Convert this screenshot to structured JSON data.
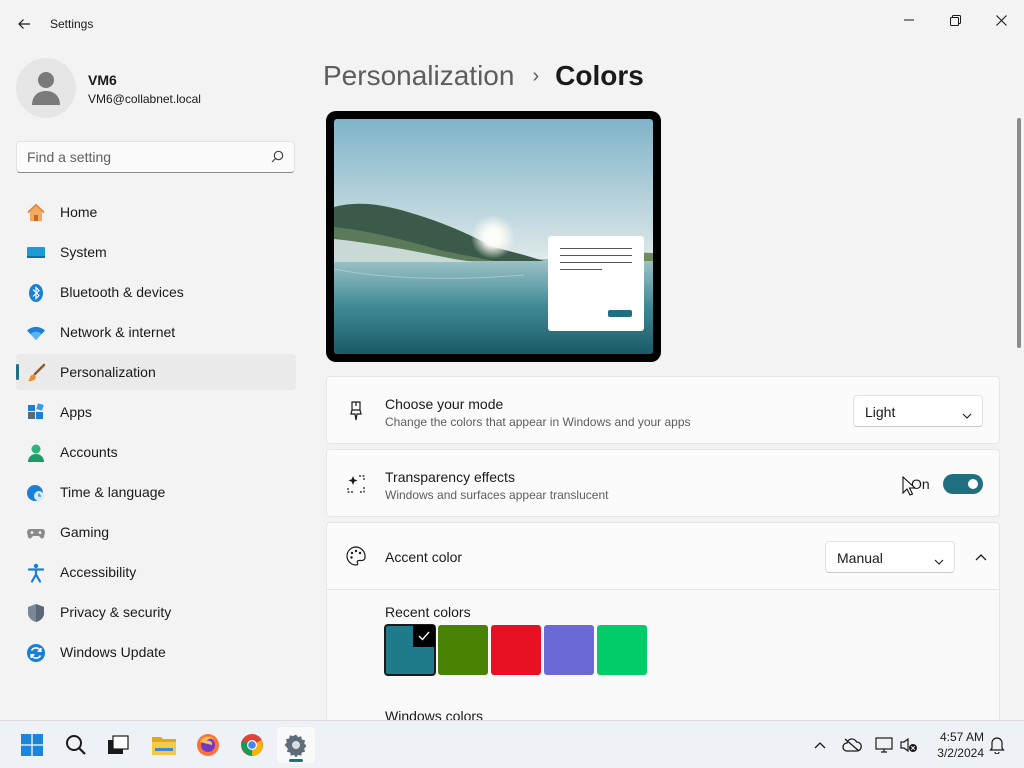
{
  "window": {
    "title": "Settings",
    "back_icon": "back-arrow-icon",
    "controls": [
      "minimize-icon",
      "restore-icon",
      "close-icon"
    ]
  },
  "profile": {
    "name": "VM6",
    "email": "VM6@collabnet.local"
  },
  "search": {
    "placeholder": "Find a setting",
    "value": ""
  },
  "sidebar": {
    "selected": "Personalization",
    "items": [
      {
        "label": "Home",
        "icon": "home-icon"
      },
      {
        "label": "System",
        "icon": "system-icon"
      },
      {
        "label": "Bluetooth & devices",
        "icon": "bluetooth-icon"
      },
      {
        "label": "Network & internet",
        "icon": "wifi-icon"
      },
      {
        "label": "Personalization",
        "icon": "brush-icon"
      },
      {
        "label": "Apps",
        "icon": "apps-icon"
      },
      {
        "label": "Accounts",
        "icon": "accounts-icon"
      },
      {
        "label": "Time & language",
        "icon": "time-language-icon"
      },
      {
        "label": "Gaming",
        "icon": "gaming-icon"
      },
      {
        "label": "Accessibility",
        "icon": "accessibility-icon"
      },
      {
        "label": "Privacy & security",
        "icon": "shield-icon"
      },
      {
        "label": "Windows Update",
        "icon": "windows-update-icon"
      }
    ]
  },
  "breadcrumb": {
    "parent": "Personalization",
    "separator": "›",
    "current": "Colors"
  },
  "mode_card": {
    "title": "Choose your mode",
    "subtitle": "Change the colors that appear in Windows and your apps",
    "value": "Light"
  },
  "transparency_card": {
    "title": "Transparency effects",
    "subtitle": "Windows and surfaces appear translucent",
    "state_label": "On",
    "enabled": true
  },
  "accent_card": {
    "title": "Accent color",
    "value": "Manual",
    "expanded": true,
    "recent_label": "Recent colors",
    "recent_colors": [
      "#1f7a8c",
      "#498205",
      "#e81123",
      "#6b69d6",
      "#00cc6a"
    ],
    "selected_index": 0,
    "windows_colors_label": "Windows colors"
  },
  "colors": {
    "accent": "#1f6f80",
    "background": "#f3f3f3",
    "card": "#fbfbfb"
  },
  "taskbar": {
    "apps": [
      "windows-start-icon",
      "search-icon",
      "task-view-icon",
      "file-explorer-icon",
      "firefox-icon",
      "chrome-icon",
      "settings-gear-icon"
    ],
    "active_app": "settings-gear-icon",
    "tray": [
      "chevron-up-icon",
      "onedrive-icon",
      "display-icon",
      "volume-mute-icon",
      "notification-bell-icon"
    ],
    "time": "4:57 AM",
    "date": "3/2/2024"
  }
}
